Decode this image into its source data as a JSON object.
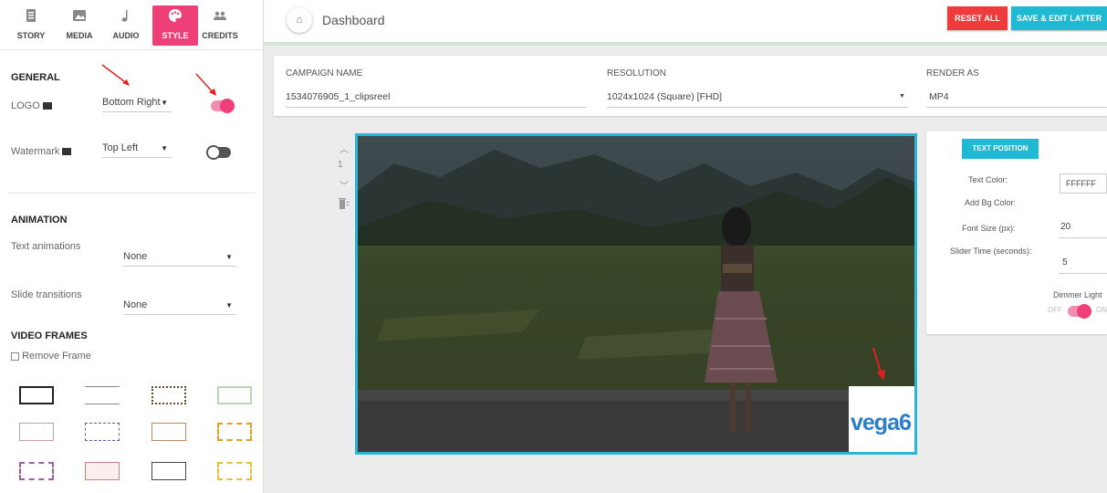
{
  "tabs": [
    {
      "label": "STORY",
      "icon": "document-icon",
      "active": false
    },
    {
      "label": "MEDIA",
      "icon": "image-icon",
      "active": false
    },
    {
      "label": "AUDIO",
      "icon": "music-note-icon",
      "active": false
    },
    {
      "label": "STYLE",
      "icon": "palette-icon",
      "active": true
    },
    {
      "label": "CREDITS",
      "icon": "people-icon",
      "active": false
    }
  ],
  "general": {
    "title": "GENERAL",
    "logo_label": "LOGO",
    "logo_position": "Bottom Right",
    "logo_enabled": true,
    "watermark_label": "Watermark",
    "watermark_position": "Top Left",
    "watermark_enabled": false
  },
  "animation": {
    "title": "ANIMATION",
    "text_label": "Text animations",
    "text_value": "None",
    "slide_label": "Slide transitions",
    "slide_value": "None"
  },
  "video_frames": {
    "title": "VIDEO FRAMES",
    "remove_label": "Remove Frame"
  },
  "header": {
    "title": "Dashboard",
    "reset_label": "RESET ALL",
    "save_label": "SAVE & EDIT LATTER"
  },
  "campaign": {
    "name_label": "CAMPAIGN NAME",
    "name_value": "1534076905_1_clipsreel",
    "resolution_label": "RESOLUTION",
    "resolution_value": "1024x1024 (Square) [FHD]",
    "render_label": "RENDER AS",
    "render_value": "MP4"
  },
  "slide": {
    "number": "1",
    "logo_text": "vega6"
  },
  "text_panel": {
    "position_button": "TEXT POSITION",
    "text_color_label": "Text Color:",
    "text_color_value": "FFFFFF",
    "bg_color_label": "Add Bg Color:",
    "font_size_label": "Font Size (px):",
    "font_size_value": "20",
    "slider_time_label": "Slider Time (seconds):",
    "slider_time_value": "5",
    "dimmer_label": "Dimmer Light",
    "dimmer_off": "OFF",
    "dimmer_on": "ON"
  },
  "colors": {
    "accent_pink": "#ef3f78",
    "reset_red": "#ef3b3b",
    "save_cyan": "#1fb9d4"
  }
}
